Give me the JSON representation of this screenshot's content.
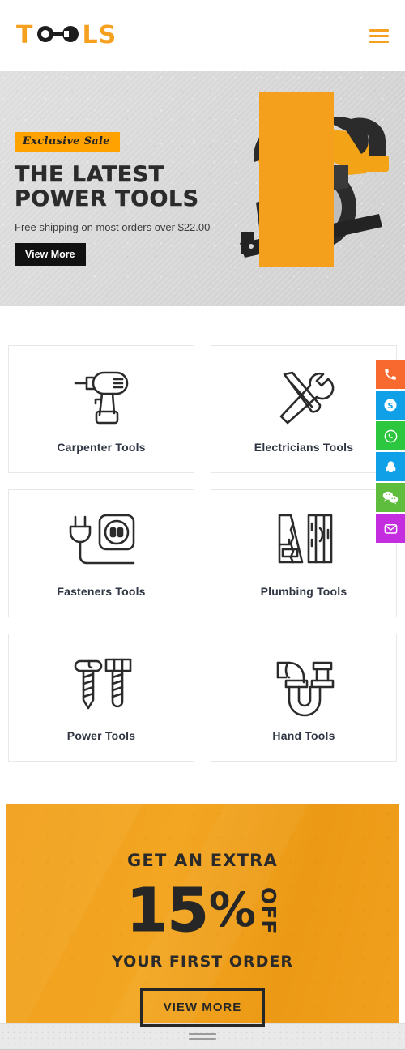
{
  "header": {
    "logo_prefix": "T",
    "logo_suffix": "LS",
    "logo_icon": "wrench-icon",
    "menu_icon": "hamburger-menu-icon",
    "brand_color": "#F5A01E"
  },
  "hero": {
    "badge": "Exclusive Sale",
    "title_line1": "THE LATEST",
    "title_line2": "POWER TOOLS",
    "subtitle": "Free shipping on most orders over $22.00",
    "button": "View More",
    "art_icon": "circular-saw-image",
    "accent_color": "#F4A01D",
    "bg_color": "#D8D8D8"
  },
  "categories": [
    {
      "label": "Carpenter Tools",
      "icon": "drill-icon"
    },
    {
      "label": "Electricians Tools",
      "icon": "screwdriver-wrench-icon"
    },
    {
      "label": "Fasteners Tools",
      "icon": "plug-socket-icon"
    },
    {
      "label": "Plumbing Tools",
      "icon": "saw-plank-icon"
    },
    {
      "label": "Power Tools",
      "icon": "screws-icon"
    },
    {
      "label": "Hand Tools",
      "icon": "pipe-trap-icon"
    }
  ],
  "promo": {
    "top_line": "GET AN EXTRA",
    "number": "15",
    "percent": "%",
    "off": "OFF",
    "bottom_line": "YOUR FIRST ORDER",
    "button": "VIEW MORE",
    "bg_color": "#F0A01C"
  },
  "social": [
    {
      "name": "phone",
      "icon": "phone-icon",
      "color": "#F8692F"
    },
    {
      "name": "skype",
      "icon": "skype-icon",
      "color": "#0FA0E8"
    },
    {
      "name": "whatsapp",
      "icon": "whatsapp-icon",
      "color": "#2CC63F"
    },
    {
      "name": "qq",
      "icon": "qq-icon",
      "color": "#0FA0E8"
    },
    {
      "name": "wechat",
      "icon": "wechat-icon",
      "color": "#5FBD3E"
    },
    {
      "name": "email",
      "icon": "envelope-icon",
      "color": "#C42CE0"
    }
  ],
  "bottom_bar": {
    "handle_icon": "drag-handle-icon"
  }
}
